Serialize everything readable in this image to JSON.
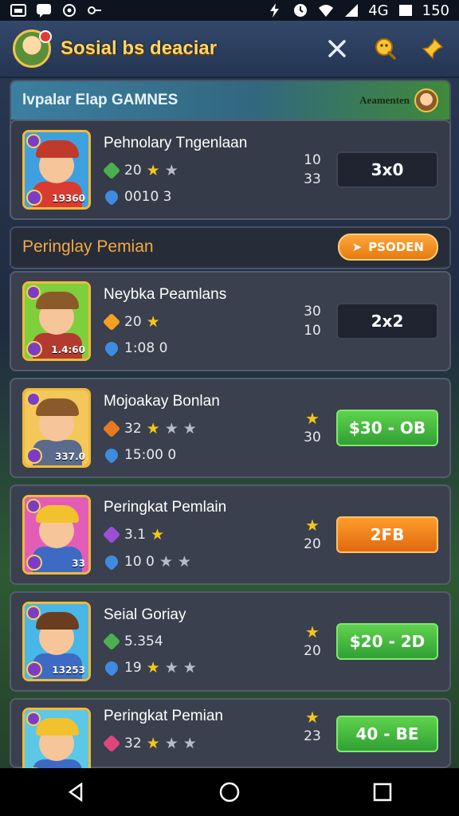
{
  "status_bar": {
    "network": "4G",
    "battery": "150",
    "icons": [
      "photo-icon",
      "chat-icon",
      "sync-icon",
      "key-icon",
      "bolt-icon",
      "clock-icon",
      "wifi-icon",
      "signal-icon",
      "battery-icon"
    ]
  },
  "header": {
    "title": "Sosial bs deaciar",
    "actions": [
      "close-icon",
      "search-icon",
      "pin-icon"
    ]
  },
  "panel1": {
    "title": "lvpalar Elap GAMNES",
    "tag": "Aeamenten"
  },
  "panel2": {
    "title": "Peringlay Pemian",
    "button": "PSODEN"
  },
  "rows": [
    {
      "name": "Pehnolary Tngenlaan",
      "level": "19360",
      "stat1": "20",
      "stat2": "0010 3",
      "num_top": "10",
      "num_bottom": "33",
      "action": "3x0",
      "portrait_color": "#3fa0e0",
      "hat_color": "#c0392b",
      "body_color": "#d83b30"
    },
    {
      "name": "Neybka Peamlans",
      "level": "1.4:60",
      "stat1": "20",
      "stat2": "1:08 0",
      "num_top": "30",
      "num_bottom": "10",
      "action": "2x2",
      "portrait_color": "#7fcf3d",
      "hat_color": "#8b5a2b",
      "body_color": "#b23a2e"
    },
    {
      "name": "Mojoakay Bonlan",
      "level": "337.0",
      "stat1": "32",
      "stat2": "15:00 0",
      "num_top": "",
      "num_bottom": "30",
      "action": "$30 - OB",
      "portrait_color": "#f3c75a",
      "hat_color": "#8b5a2b",
      "body_color": "#5b6b8c"
    },
    {
      "name": "Peringkat Pemlain",
      "level": "33",
      "stat1": "3.1",
      "stat2": "10  0",
      "num_top": "",
      "num_bottom": "20",
      "action": "2FB",
      "portrait_color": "#e35db8",
      "hat_color": "#f2c12e",
      "body_color": "#3d6bc4"
    },
    {
      "name": "Seial Goriay",
      "level": "13253",
      "stat1": "5.354",
      "stat2": "19",
      "num_top": "",
      "num_bottom": "20",
      "action": "$20 - 2D",
      "portrait_color": "#49b6e8",
      "hat_color": "#6b3d1f",
      "body_color": "#3d6bc4"
    },
    {
      "name": "Peringkat Pemian",
      "level": "",
      "stat1": "32",
      "stat2": "",
      "num_top": "",
      "num_bottom": "23",
      "action": "40 - BE",
      "portrait_color": "#5cc8e6",
      "hat_color": "#f2c12e",
      "body_color": "#3d6bc4"
    }
  ],
  "navbar": [
    "back-icon",
    "home-icon",
    "recents-icon"
  ]
}
